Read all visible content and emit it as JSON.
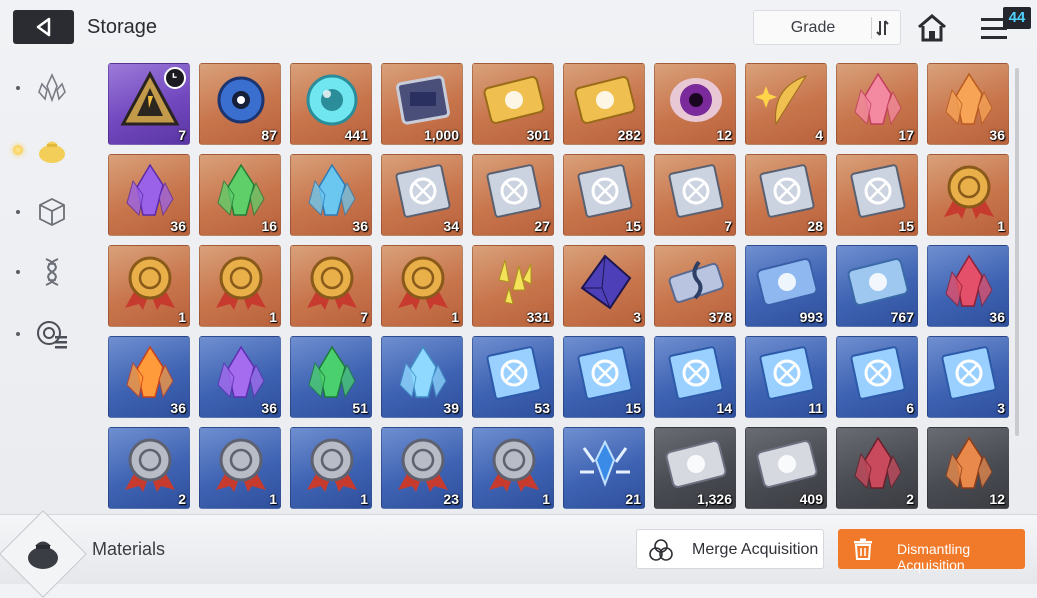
{
  "header": {
    "title": "Storage",
    "grade_label": "Grade",
    "notification_count": "44"
  },
  "side_nav": [
    {
      "icon": "crystal-cluster-icon",
      "active": false
    },
    {
      "icon": "materials-pouch-icon",
      "active": true
    },
    {
      "icon": "cube-icon",
      "active": false
    },
    {
      "icon": "dna-helix-icon",
      "active": false
    },
    {
      "icon": "target-list-icon",
      "active": false
    }
  ],
  "grid": [
    [
      {
        "item": "triangle-module-icon",
        "qty": "7",
        "bg": "purple",
        "timer": true
      },
      {
        "item": "blue-orb-creature-icon",
        "qty": "87",
        "bg": "orange"
      },
      {
        "item": "glass-sphere-icon",
        "qty": "441",
        "bg": "orange"
      },
      {
        "item": "data-chip-icon",
        "qty": "1,000",
        "bg": "orange"
      },
      {
        "item": "gold-ticket-icon",
        "qty": "301",
        "bg": "orange"
      },
      {
        "item": "gold-compass-ticket-icon",
        "qty": "282",
        "bg": "orange"
      },
      {
        "item": "purple-eye-orb-icon",
        "qty": "12",
        "bg": "orange"
      },
      {
        "item": "gold-crescent-feather-icon",
        "qty": "4",
        "bg": "orange"
      },
      {
        "item": "pink-crystal-icon",
        "qty": "17",
        "bg": "orange"
      },
      {
        "item": "orange-crystal-icon",
        "qty": "36",
        "bg": "orange"
      }
    ],
    [
      {
        "item": "purple-crystal-icon",
        "qty": "36",
        "bg": "orange"
      },
      {
        "item": "green-crystal-icon",
        "qty": "16",
        "bg": "orange"
      },
      {
        "item": "blue-crystal-icon",
        "qty": "36",
        "bg": "orange"
      },
      {
        "item": "sword-book-icon",
        "qty": "34",
        "bg": "orange"
      },
      {
        "item": "shield-book-icon",
        "qty": "27",
        "bg": "orange"
      },
      {
        "item": "eye-book-icon",
        "qty": "15",
        "bg": "orange"
      },
      {
        "item": "wing-book-icon",
        "qty": "7",
        "bg": "orange"
      },
      {
        "item": "lightning-book-icon",
        "qty": "28",
        "bg": "orange"
      },
      {
        "item": "circle-book-icon",
        "qty": "15",
        "bg": "orange"
      },
      {
        "item": "gold-medal-plus-icon",
        "qty": "1",
        "bg": "orange"
      }
    ],
    [
      {
        "item": "gold-medal-shield-icon",
        "qty": "1",
        "bg": "orange"
      },
      {
        "item": "gold-medal-wings-icon",
        "qty": "1",
        "bg": "orange"
      },
      {
        "item": "gold-medal-bolt-icon",
        "qty": "7",
        "bg": "orange"
      },
      {
        "item": "gold-medal-circle-icon",
        "qty": "1",
        "bg": "orange"
      },
      {
        "item": "yellow-shards-icon",
        "qty": "331",
        "bg": "orange"
      },
      {
        "item": "dark-cube-gem-icon",
        "qty": "3",
        "bg": "orange"
      },
      {
        "item": "music-scroll-icon",
        "qty": "378",
        "bg": "orange"
      },
      {
        "item": "blue-ticket-icon",
        "qty": "993",
        "bg": "blue"
      },
      {
        "item": "blue-compass-ticket-icon",
        "qty": "767",
        "bg": "blue"
      },
      {
        "item": "red-crystal-icon",
        "qty": "36",
        "bg": "blue"
      }
    ],
    [
      {
        "item": "fire-crystal-icon",
        "qty": "36",
        "bg": "blue"
      },
      {
        "item": "violet-crystal-icon",
        "qty": "36",
        "bg": "blue"
      },
      {
        "item": "emerald-crystal-icon",
        "qty": "51",
        "bg": "blue"
      },
      {
        "item": "ice-crystal-icon",
        "qty": "39",
        "bg": "blue"
      },
      {
        "item": "blue-sword-book-icon",
        "qty": "53",
        "bg": "blue"
      },
      {
        "item": "blue-shield-book-icon",
        "qty": "15",
        "bg": "blue"
      },
      {
        "item": "blue-eye-book-icon",
        "qty": "14",
        "bg": "blue"
      },
      {
        "item": "blue-wing-book-icon",
        "qty": "11",
        "bg": "blue"
      },
      {
        "item": "blue-lightning-book-icon",
        "qty": "6",
        "bg": "blue"
      },
      {
        "item": "blue-circle-book-icon",
        "qty": "3",
        "bg": "blue"
      }
    ],
    [
      {
        "item": "silver-medal-plus-icon",
        "qty": "2",
        "bg": "blue"
      },
      {
        "item": "silver-medal-shield-icon",
        "qty": "1",
        "bg": "blue"
      },
      {
        "item": "silver-medal-wings-icon",
        "qty": "1",
        "bg": "blue"
      },
      {
        "item": "silver-medal-bolt-icon",
        "qty": "23",
        "bg": "blue"
      },
      {
        "item": "silver-medal-circle-icon",
        "qty": "1",
        "bg": "blue"
      },
      {
        "item": "blue-shard-burst-icon",
        "qty": "21",
        "bg": "blue"
      },
      {
        "item": "silver-ticket-icon",
        "qty": "1,326",
        "bg": "gray"
      },
      {
        "item": "silver-compass-ticket-icon",
        "qty": "409",
        "bg": "gray"
      },
      {
        "item": "rose-crystal-icon",
        "qty": "2",
        "bg": "gray"
      },
      {
        "item": "amber-crystal-icon",
        "qty": "12",
        "bg": "gray"
      }
    ]
  ],
  "footer": {
    "category_label": "Materials",
    "merge_label": "Merge Acquisition",
    "dismantle_label": "Dismantling Acquisition"
  }
}
